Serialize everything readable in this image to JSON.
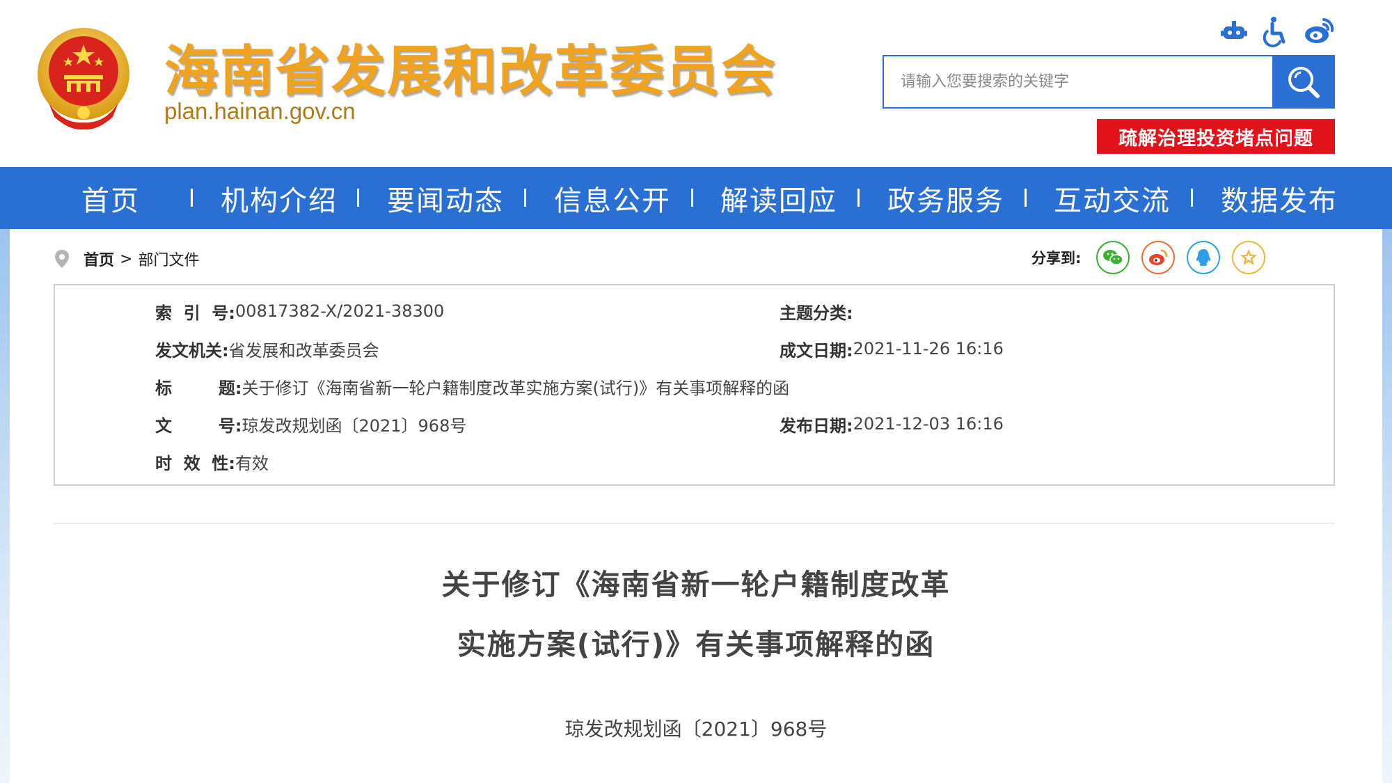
{
  "header": {
    "site_title": "海南省发展和改革委员会",
    "site_domain": "plan.hainan.gov.cn",
    "search_placeholder": "请输入您要搜索的关键字",
    "special_button": "疏解治理投资堵点问题",
    "top_icons": [
      "robot-icon",
      "accessibility-icon",
      "weibo-icon"
    ]
  },
  "nav": {
    "items": [
      "首页",
      "机构介绍",
      "要闻动态",
      "信息公开",
      "解读回应",
      "政务服务",
      "互动交流",
      "数据发布"
    ]
  },
  "breadcrumb": {
    "home": "首页",
    "separator": ">",
    "current": "部门文件"
  },
  "share": {
    "label": "分享到:",
    "targets": [
      "wechat-icon",
      "weibo-icon",
      "qq-icon",
      "favorite-icon"
    ]
  },
  "info": {
    "index_key": "索  引  号:",
    "index_val": "00817382-X/2021-38300",
    "topic_key": "主题分类:",
    "topic_val": "",
    "issuer_key": "发文机关:",
    "issuer_val": "省发展和改革委员会",
    "created_key": "成文日期:",
    "created_val": "2021-11-26 16:16",
    "title_key": "标        题:",
    "title_val": "关于修订《海南省新一轮户籍制度改革实施方案(试行)》有关事项解释的函",
    "docno_key": "文        号:",
    "docno_val": "琼发改规划函〔2021〕968号",
    "published_key": "发布日期:",
    "published_val": "2021-12-03 16:16",
    "validity_key": "时  效  性:",
    "validity_val": "有效"
  },
  "article": {
    "title_line1": "关于修订《海南省新一轮户籍制度改革",
    "title_line2": "实施方案(试行)》有关事项解释的函",
    "doc_number": "琼发改规划函〔2021〕968号"
  },
  "colors": {
    "nav_blue": "#2a6fd4",
    "title_gold": "#f0a31e",
    "alert_red": "#e3131b"
  }
}
